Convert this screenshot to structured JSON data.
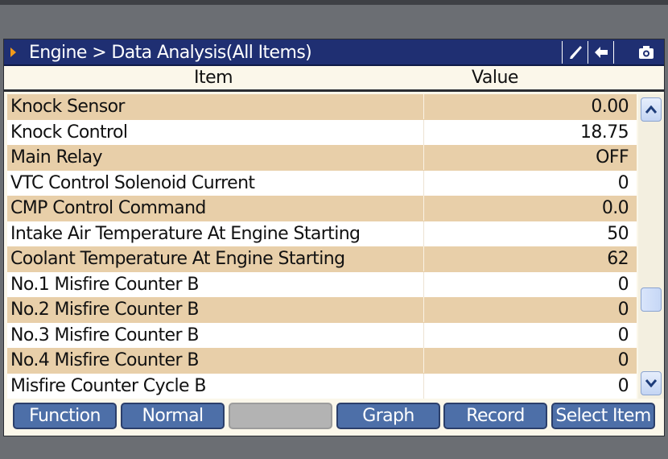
{
  "header": {
    "breadcrumb": "Engine > Data Analysis(All Items)",
    "icons": [
      "pen-icon",
      "back-arrow-icon",
      "camera-icon"
    ]
  },
  "columns": {
    "item": "Item",
    "value": "Value"
  },
  "rows": [
    {
      "item": "Knock Sensor",
      "value": "0.00"
    },
    {
      "item": "Knock Control",
      "value": "18.75"
    },
    {
      "item": "Main Relay",
      "value": "OFF"
    },
    {
      "item": "VTC Control Solenoid Current",
      "value": "0"
    },
    {
      "item": "CMP Control Command",
      "value": "0.0"
    },
    {
      "item": "Intake Air Temperature At Engine Starting",
      "value": "50"
    },
    {
      "item": "Coolant Temperature At Engine Starting",
      "value": "62"
    },
    {
      "item": "No.1 Misfire Counter B",
      "value": "0"
    },
    {
      "item": "No.2 Misfire Counter B",
      "value": "0"
    },
    {
      "item": "No.3 Misfire Counter B",
      "value": "0"
    },
    {
      "item": "No.4 Misfire Counter B",
      "value": "0"
    },
    {
      "item": "Misfire Counter Cycle B",
      "value": "0"
    }
  ],
  "buttons": {
    "function": "Function",
    "normal": "Normal",
    "empty": "",
    "graph": "Graph",
    "record": "Record",
    "select_item": "Select Item"
  },
  "colors": {
    "title_bg": "#1f2f72",
    "row_odd": "#e8cfa9",
    "row_even": "#ffffff",
    "button_bg": "#4d6fa8",
    "accent_arrow": "#f29a1a"
  }
}
